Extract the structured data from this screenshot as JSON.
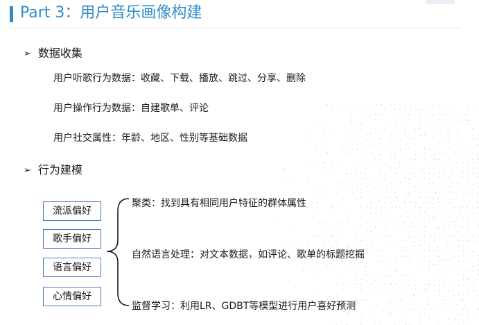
{
  "header": {
    "title": "Part 3：用户音乐画像构建"
  },
  "section_collect": {
    "heading": "数据收集",
    "bullet_icon": "arrow-right-bullet",
    "lines": [
      "用户听歌行为数据：收藏、下载、播放、跳过、分享、删除",
      "用户操作行为数据：自建歌单、评论",
      "用户社交属性：年龄、地区、性别等基础数据"
    ]
  },
  "section_model": {
    "heading": "行为建模",
    "bullet_icon": "arrow-right-bullet",
    "preferences": [
      "流派偏好",
      "歌手偏好",
      "语言偏好",
      "心情偏好"
    ],
    "methods": [
      "聚类：找到具有相同用户特征的群体属性",
      "自然语言处理：对文本数据，如评论、歌单的标题挖掘",
      "监督学习：利用LR、GDBT等模型进行用户喜好预测"
    ]
  },
  "colors": {
    "accent": "#2d8cc8",
    "box_border": "#4a7ab8"
  }
}
